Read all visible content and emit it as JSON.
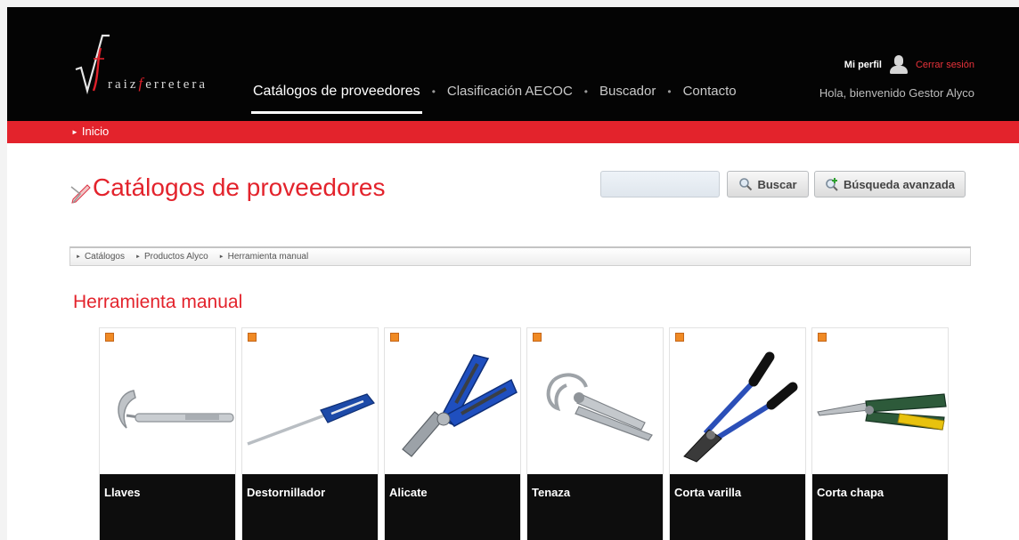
{
  "brand": {
    "wordmark_pre": "raiz",
    "wordmark_f": "f",
    "wordmark_post": "erretera"
  },
  "nav": {
    "items": [
      {
        "label": "Catálogos de proveedores",
        "active": true
      },
      {
        "label": "Clasificación AECOC",
        "active": false
      },
      {
        "label": "Buscador",
        "active": false
      },
      {
        "label": "Contacto",
        "active": false
      }
    ],
    "separator": "•"
  },
  "user": {
    "profile_label": "Mi perfil",
    "logout_label": "Cerrar sesión",
    "welcome": "Hola, bienvenido Gestor Alyco",
    "icon": "user-icon"
  },
  "topbar": {
    "home_label": "Inicio"
  },
  "page": {
    "title": "Catálogos de proveedores",
    "title_icon": "edit-icon"
  },
  "search": {
    "value": "",
    "placeholder": "",
    "search_button": "Buscar",
    "advanced_button": "Búsqueda avanzada"
  },
  "breadcrumb": [
    {
      "label": "Catálogos"
    },
    {
      "label": "Productos Alyco"
    },
    {
      "label": "Herramienta manual"
    }
  ],
  "section": {
    "title": "Herramienta manual"
  },
  "products": [
    {
      "label": "Llaves",
      "icon": "hook-wrench-image"
    },
    {
      "label": "Destornillador",
      "icon": "screwdriver-image"
    },
    {
      "label": "Alicate",
      "icon": "pliers-image"
    },
    {
      "label": "Tenaza",
      "icon": "locking-pliers-image"
    },
    {
      "label": "Corta varilla",
      "icon": "bolt-cutter-image"
    },
    {
      "label": "Corta chapa",
      "icon": "tin-snips-image"
    }
  ],
  "colors": {
    "accent_red": "#e3232c",
    "header_black": "#040404",
    "checkbox_orange": "#f08a24",
    "tool_blue": "#2b4fb8"
  }
}
